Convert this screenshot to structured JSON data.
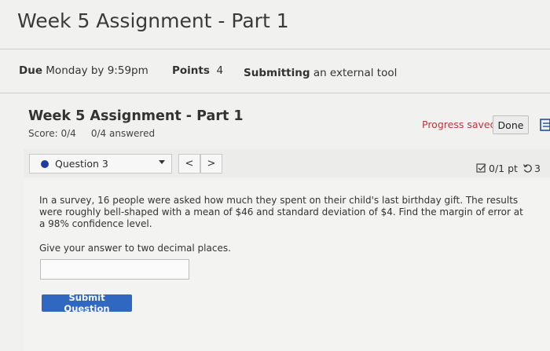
{
  "page": {
    "title": "Week 5 Assignment - Part 1"
  },
  "meta": {
    "due_label": "Due",
    "due_value": "Monday by 9:59pm",
    "points_label": "Points",
    "points_value": "4",
    "submitting_label": "Submitting",
    "submitting_value": "an external tool"
  },
  "assignment": {
    "title": "Week 5 Assignment - Part 1",
    "score": "Score: 0/4",
    "answered": "0/4 answered",
    "progress_status": "Progress saved",
    "done_label": "Done"
  },
  "question_nav": {
    "selected": "Question 3",
    "prev": "<",
    "next": ">",
    "points": "0/1 pt",
    "retries": "3"
  },
  "question": {
    "text": "In a survey, 16 people were asked how much they spent on their child's last birthday gift. The results were roughly bell-shaped with a mean of $46 and standard deviation of $4. Find the margin of error at a 98% confidence level.",
    "instructions": "Give your answer to two decimal places.",
    "answer_value": "",
    "submit_label": "Submit Question"
  },
  "colors": {
    "accent_blue": "#2f67c1",
    "progress_red": "#b5373d",
    "dot_blue": "#1f3e9c"
  }
}
